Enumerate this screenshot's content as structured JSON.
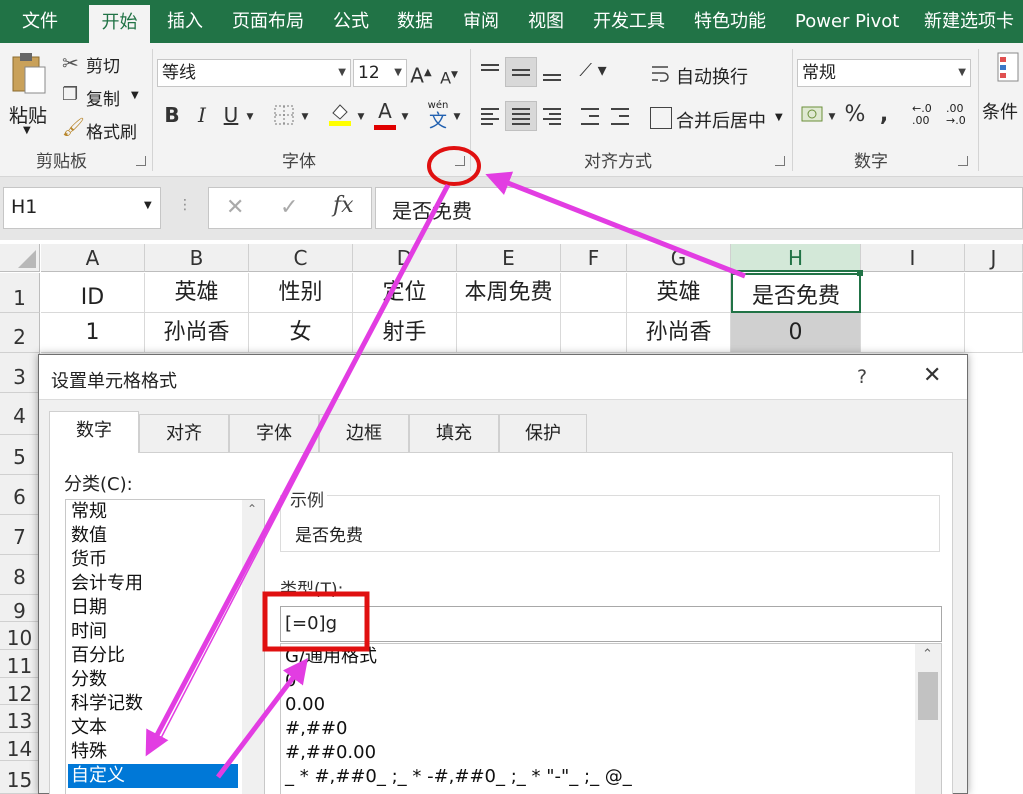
{
  "tabs": [
    "文件",
    "开始",
    "插入",
    "页面布局",
    "公式",
    "数据",
    "审阅",
    "视图",
    "开发工具",
    "特色功能",
    "Power Pivot",
    "新建选项卡"
  ],
  "active_tab": "开始",
  "ribbon": {
    "clipboard": {
      "paste": "粘贴",
      "cut": "剪切",
      "copy": "复制",
      "format_painter": "格式刷",
      "group": "剪贴板"
    },
    "font": {
      "name": "等线",
      "size": "12",
      "group": "字体",
      "bold": "B",
      "italic": "I",
      "underline": "U",
      "grow": "A",
      "shrink": "A",
      "font_color": "A",
      "phonetic_top": "wén",
      "phonetic_bottom": "文"
    },
    "alignment": {
      "wrap": "自动换行",
      "merge": "合并后居中",
      "group": "对齐方式"
    },
    "number": {
      "format": "常规",
      "percent": "%",
      "comma": ",",
      "inc_decimal": [
        "←.0",
        ".00"
      ],
      "dec_decimal": [
        ".00",
        "→.0"
      ],
      "group": "数字"
    },
    "styles": {
      "conditional": "条件"
    }
  },
  "formula_bar": {
    "name_box": "H1",
    "formula": "是否免费",
    "fx": "fx",
    "cancel": "✕",
    "confirm": "✓"
  },
  "sheet": {
    "columns": [
      "A",
      "B",
      "C",
      "D",
      "E",
      "F",
      "G",
      "H",
      "I",
      "J"
    ],
    "rows": [
      "1",
      "2",
      "3",
      "4",
      "5",
      "6",
      "7",
      "8",
      "9",
      "10",
      "11",
      "12",
      "13",
      "14",
      "15"
    ],
    "row1": {
      "A": "ID",
      "B": "英雄",
      "C": "性别",
      "D": "定位",
      "E": "本周免费",
      "G": "英雄",
      "H": "是否免费"
    },
    "row2": {
      "A": "1",
      "B": "孙尚香",
      "C": "女",
      "D": "射手",
      "G": "孙尚香",
      "H": "0"
    }
  },
  "dialog": {
    "title": "设置单元格格式",
    "help": "?",
    "close": "✕",
    "tabs": [
      "数字",
      "对齐",
      "字体",
      "边框",
      "填充",
      "保护"
    ],
    "category_label": "分类(C):",
    "categories": [
      "常规",
      "数值",
      "货币",
      "会计专用",
      "日期",
      "时间",
      "百分比",
      "分数",
      "科学记数",
      "文本",
      "特殊",
      "自定义"
    ],
    "selected_category": "自定义",
    "sample_label": "示例",
    "sample_value": "是否免费",
    "type_label": "类型(T):",
    "type_value": "[=0]g",
    "type_list": [
      "G/通用格式",
      "0",
      "0.00",
      "#,##0",
      "#,##0.00",
      "_ * #,##0_ ;_ * -#,##0_ ;_ * \"-\"_ ;_ @_"
    ]
  },
  "colors": {
    "excel_green": "#217346",
    "annotation_magenta": "#e23de2",
    "annotation_red": "#e01010",
    "selection_blue": "#0078d7"
  }
}
